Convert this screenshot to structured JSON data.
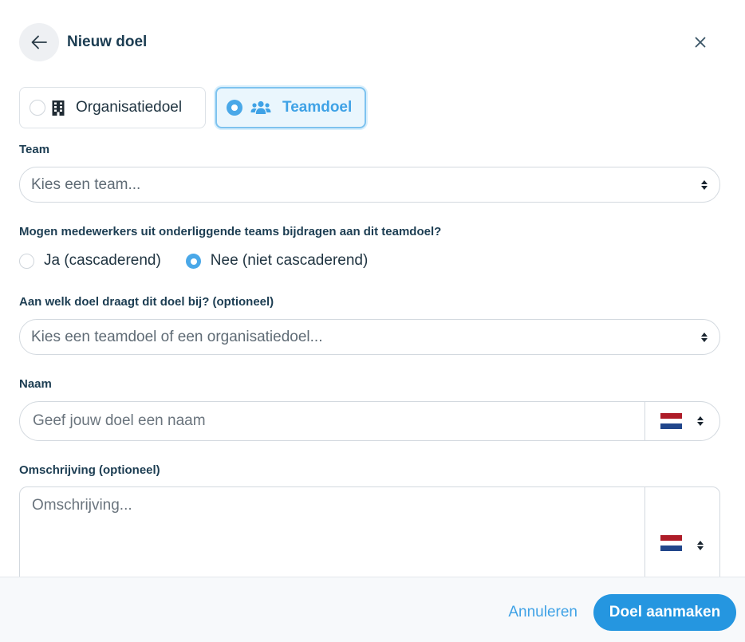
{
  "header": {
    "title": "Nieuw doel",
    "back_icon": "arrow-left-icon",
    "close_icon": "close-icon"
  },
  "goal_type": {
    "options": [
      {
        "label": "Organisatiedoel",
        "icon": "building-icon",
        "selected": false
      },
      {
        "label": "Teamdoel",
        "icon": "users-icon",
        "selected": true
      }
    ]
  },
  "team": {
    "label": "Team",
    "placeholder": "Kies een team..."
  },
  "cascading": {
    "question": "Mogen medewerkers uit onderliggende teams bijdragen aan dit teamdoel?",
    "options": [
      {
        "label": "Ja (cascaderend)",
        "selected": false
      },
      {
        "label": "Nee (niet cascaderend)",
        "selected": true
      }
    ]
  },
  "parent_goal": {
    "label": "Aan welk doel draagt dit doel bij? (optioneel)",
    "placeholder": "Kies een teamdoel of een organisatiedoel..."
  },
  "name": {
    "label": "Naam",
    "placeholder": "Geef jouw doel een naam",
    "language_flag": "netherlands-flag-icon"
  },
  "description": {
    "label": "Omschrijving (optioneel)",
    "placeholder": "Omschrijving...",
    "language_flag": "netherlands-flag-icon"
  },
  "footer": {
    "cancel_label": "Annuleren",
    "submit_label": "Doel aanmaken"
  },
  "colors": {
    "accent": "#2596e0",
    "accent_light": "#3fa2e6",
    "heading": "#1c3d52",
    "flag_red": "#ae1c28",
    "flag_white": "#ffffff",
    "flag_blue": "#21468b"
  }
}
